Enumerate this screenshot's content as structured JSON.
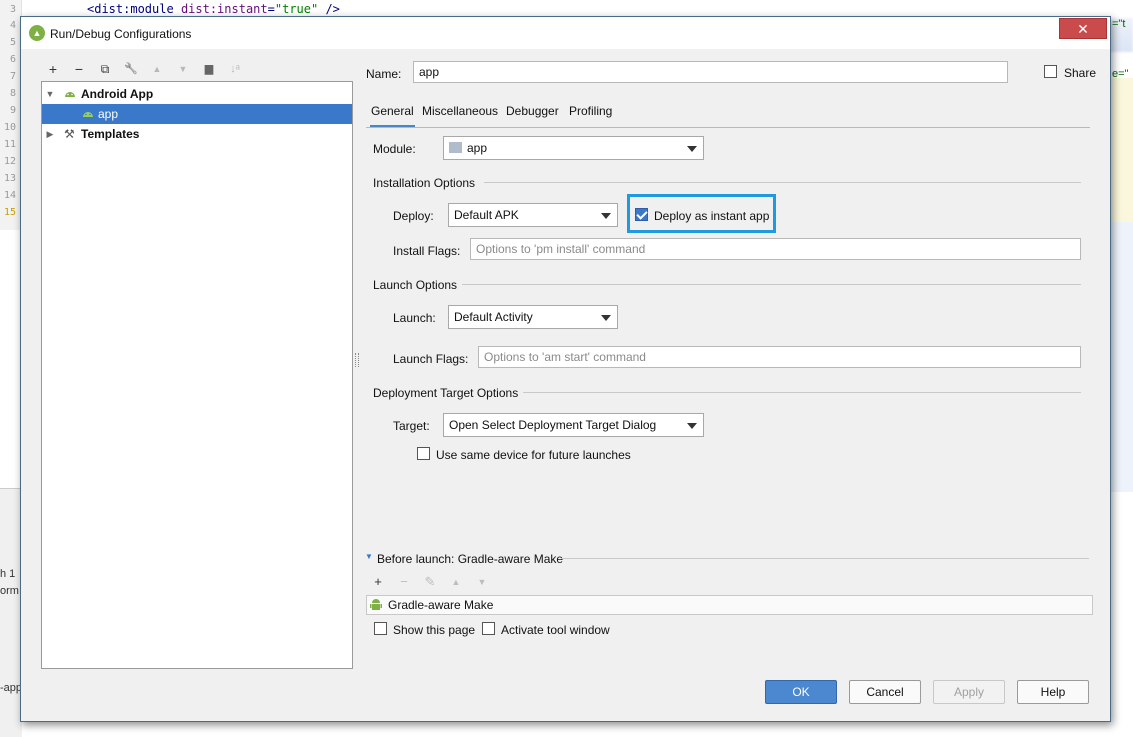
{
  "editor": {
    "line_numbers": [
      "3",
      "4",
      "5",
      "6",
      "7",
      "8",
      "9",
      "10",
      "11",
      "12",
      "13",
      "14",
      "15"
    ],
    "code_tag": "<dist:module",
    "code_attr": "dist:instant",
    "code_eq": "=",
    "code_value": "\"true\"",
    "code_end": " />",
    "edge_texts": [
      "h 1",
      "orm",
      "-app",
      "=\"t",
      "e=\""
    ]
  },
  "dialog": {
    "title": "Run/Debug Configurations",
    "close_glyph": "✕"
  },
  "tree_toolbar": {
    "add": "+",
    "remove": "−",
    "copy": "⧉",
    "edit": "🔧",
    "up": "▲",
    "down": "▼",
    "folder": "▆",
    "sort": "↓ᵃ"
  },
  "tree": {
    "android_app_label": "Android App",
    "app_label": "app",
    "templates_label": "Templates"
  },
  "name_row": {
    "label": "Name:",
    "value": "app",
    "share_label": "Share",
    "share_checked": false
  },
  "tabs": [
    "General",
    "Miscellaneous",
    "Debugger",
    "Profiling"
  ],
  "module": {
    "label": "Module:",
    "value": "app"
  },
  "installation": {
    "section": "Installation Options",
    "deploy_label": "Deploy:",
    "deploy_value": "Default APK",
    "instant_label": "Deploy as instant app",
    "instant_checked": true,
    "flags_label": "Install Flags:",
    "flags_placeholder": "Options to 'pm install' command"
  },
  "launch": {
    "section": "Launch Options",
    "launch_label": "Launch:",
    "launch_value": "Default Activity",
    "flags_label": "Launch Flags:",
    "flags_placeholder": "Options to 'am start' command"
  },
  "target": {
    "section": "Deployment Target Options",
    "target_label": "Target:",
    "target_value": "Open Select Deployment Target Dialog",
    "same_device_label": "Use same device for future launches",
    "same_device_checked": false
  },
  "before_launch": {
    "title": "Before launch: Gradle-aware Make",
    "toolbar": {
      "add": "+",
      "remove": "−",
      "edit": "✎",
      "up": "▲",
      "down": "▼"
    },
    "item": "Gradle-aware Make",
    "show_page_label": "Show this page",
    "activate_label": "Activate tool window"
  },
  "buttons": {
    "ok": "OK",
    "cancel": "Cancel",
    "apply": "Apply",
    "help": "Help"
  },
  "colors": {
    "accent": "#4b88cf",
    "highlight_box": "#1f9ae0",
    "selection": "#3a78c9",
    "android_green": "#7fb045"
  }
}
